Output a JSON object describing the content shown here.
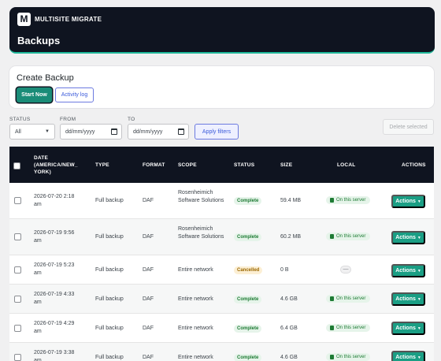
{
  "header": {
    "logo": "M",
    "brand": "MULTISITE MIGRATE",
    "title": "Backups"
  },
  "create": {
    "title": "Create Backup",
    "start_label": "Start Now",
    "log_label": "Activity log"
  },
  "filters": {
    "status_label": "STATUS",
    "status_value": "All",
    "from_label": "FROM",
    "from_placeholder": "dd/mm/yyyy",
    "to_label": "TO",
    "to_placeholder": "dd/mm/yyyy",
    "apply_label": "Apply filters",
    "delete_label": "Delete selected"
  },
  "table": {
    "headers": {
      "date": "DATE (AMERICA/NEW_ YORK)",
      "type": "TYPE",
      "format": "FORMAT",
      "scope": "SCOPE",
      "status": "STATUS",
      "size": "SIZE",
      "local": "LOCAL",
      "actions": "ACTIONS"
    },
    "action_label": "Actions",
    "rows": [
      {
        "date": "2026-07-20 2:18 am",
        "type": "Full backup",
        "format": "DAF",
        "scope": "Rosenheimich Software Solutions",
        "status": "Complete",
        "size": "59.4 MB",
        "local": "On this server"
      },
      {
        "date": "2026-07-19 9:56 am",
        "type": "Full backup",
        "format": "DAF",
        "scope": "Rosenheimich Software Solutions",
        "status": "Complete",
        "size": "60.2 MB",
        "local": "On this server"
      },
      {
        "date": "2026-07-19 5:23 am",
        "type": "Full backup",
        "format": "DAF",
        "scope": "Entire network",
        "status": "Cancelled",
        "size": "0 B",
        "local": "—"
      },
      {
        "date": "2026-07-19 4:33 am",
        "type": "Full backup",
        "format": "DAF",
        "scope": "Entire network",
        "status": "Complete",
        "size": "4.6 GB",
        "local": "On this server"
      },
      {
        "date": "2026-07-19 4:29 am",
        "type": "Full backup",
        "format": "DAF",
        "scope": "Entire network",
        "status": "Complete",
        "size": "6.4 GB",
        "local": "On this server"
      },
      {
        "date": "2026-07-19 3:38 am",
        "type": "Full backup",
        "format": "DAF",
        "scope": "Entire network",
        "status": "Complete",
        "size": "4.6 GB",
        "local": "On this server"
      }
    ]
  },
  "colors": {
    "header_bg": "#0f1420",
    "accent": "#1a9e84",
    "link": "#3b5bdb"
  }
}
